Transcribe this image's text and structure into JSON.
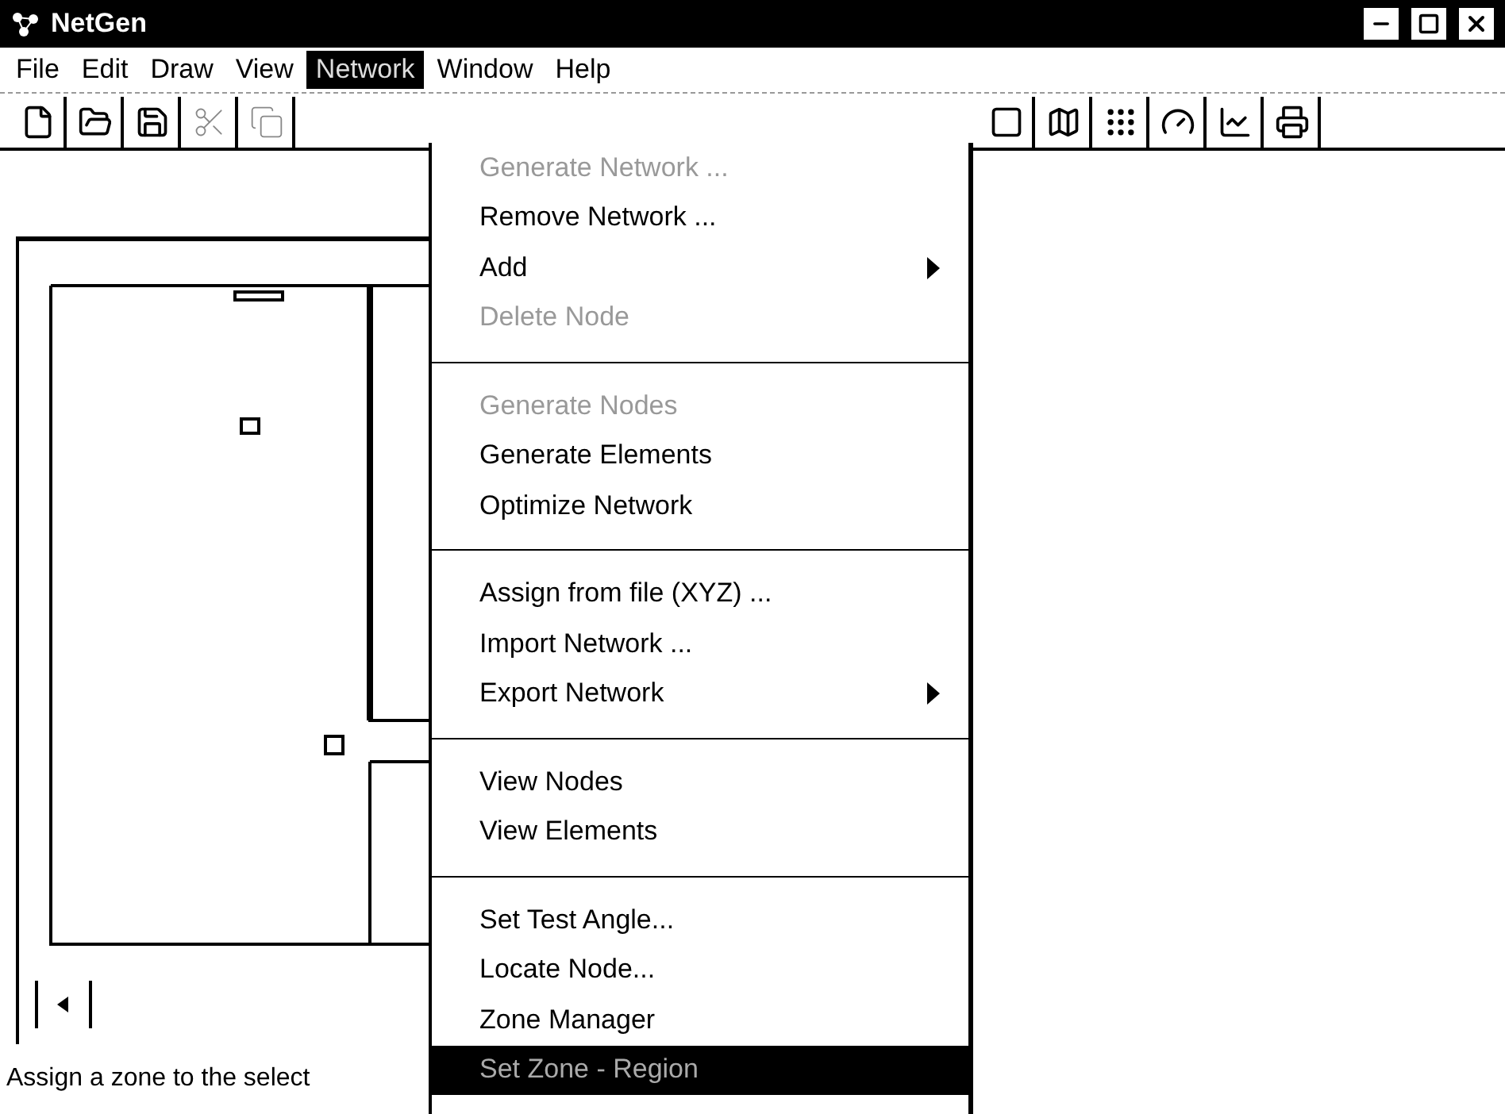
{
  "window": {
    "title": "NetGen"
  },
  "menubar": [
    {
      "label": "File",
      "selected": false
    },
    {
      "label": "Edit",
      "selected": false
    },
    {
      "label": "Draw",
      "selected": false
    },
    {
      "label": "View",
      "selected": false
    },
    {
      "label": "Network",
      "selected": true
    },
    {
      "label": "Window",
      "selected": false
    },
    {
      "label": "Help",
      "selected": false
    }
  ],
  "menu": [
    {
      "kind": "item",
      "label": "Generate Network ...",
      "disabled": true,
      "submenu": false,
      "selected": false
    },
    {
      "kind": "item",
      "label": "Remove Network ...",
      "disabled": false,
      "submenu": false,
      "selected": false
    },
    {
      "kind": "item",
      "label": "Add",
      "disabled": false,
      "submenu": true,
      "selected": false
    },
    {
      "kind": "item",
      "label": "Delete Node",
      "disabled": true,
      "submenu": false,
      "selected": false
    },
    {
      "kind": "separator"
    },
    {
      "kind": "item",
      "label": "Generate Nodes",
      "disabled": true,
      "submenu": false,
      "selected": false
    },
    {
      "kind": "item",
      "label": "Generate Elements",
      "disabled": false,
      "submenu": false,
      "selected": false
    },
    {
      "kind": "item",
      "label": "Optimize Network",
      "disabled": false,
      "submenu": false,
      "selected": false
    },
    {
      "kind": "separator"
    },
    {
      "kind": "item",
      "label": "Assign from file (XYZ) ...",
      "disabled": false,
      "submenu": false,
      "selected": false
    },
    {
      "kind": "item",
      "label": "Import Network ...",
      "disabled": false,
      "submenu": false,
      "selected": false
    },
    {
      "kind": "item",
      "label": "Export Network",
      "disabled": false,
      "submenu": true,
      "selected": false
    },
    {
      "kind": "separator"
    },
    {
      "kind": "item",
      "label": "View Nodes",
      "disabled": false,
      "submenu": false,
      "selected": false
    },
    {
      "kind": "item",
      "label": "View Elements",
      "disabled": false,
      "submenu": false,
      "selected": false
    },
    {
      "kind": "separator"
    },
    {
      "kind": "item",
      "label": "Set Test Angle...",
      "disabled": false,
      "submenu": false,
      "selected": false
    },
    {
      "kind": "item",
      "label": "Locate Node...",
      "disabled": false,
      "submenu": false,
      "selected": false
    },
    {
      "kind": "item",
      "label": "Zone Manager",
      "disabled": false,
      "submenu": false,
      "selected": false
    },
    {
      "kind": "item",
      "label": "Set Zone - Region",
      "disabled": true,
      "submenu": false,
      "selected": true
    }
  ],
  "status_bar": {
    "text": "Assign a zone to the select"
  }
}
